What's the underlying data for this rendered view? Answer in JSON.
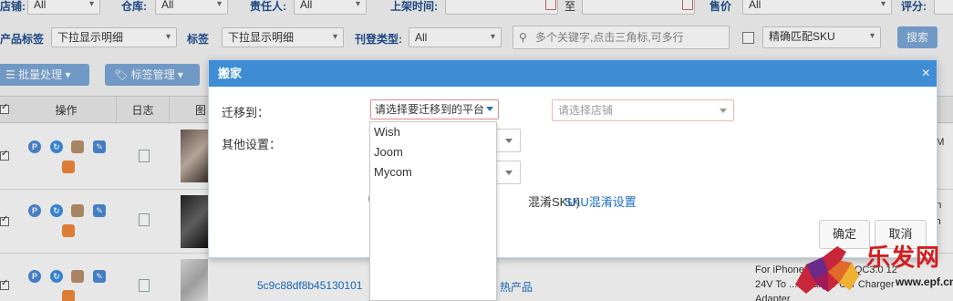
{
  "filters_row1": {
    "store_label": "店铺:",
    "store_value": "All",
    "warehouse_label": "仓库:",
    "warehouse_value": "All",
    "owner_label": "责任人:",
    "owner_value": "All",
    "listing_time_label": "上架时间:",
    "range_to": "至",
    "price_label": "售价",
    "price_value": "All",
    "rating_label": "评分:"
  },
  "filters_row2": {
    "product_tag_label": "产品标签",
    "product_tag_value": "下拉显示明细",
    "tag_label": "标签",
    "tag_value": "下拉显示明细",
    "publish_type_label": "刊登类型:",
    "publish_type_value": "All",
    "keyword_placeholder": "多个关键字,点击三角标,可多行",
    "exact_sku_label": "精确匹配SKU",
    "search_button": "搜索"
  },
  "toolbar": {
    "batch_label": "批量处理",
    "tag_manage_label": "标签管理"
  },
  "table": {
    "headers": [
      "操作",
      "日志",
      "图"
    ],
    "rows": [
      {
        "right_text": "nt M"
      },
      {
        "right_text": "hon\nach"
      },
      {
        "sku_link": "5c9c88df8b45130101",
        "hot_label": "热产品",
        "desc_line1": "For iPhone ... Huawei QC3.0 12",
        "desc_line2": "24V To ... Charger Car Charger",
        "desc_line3": "Adapter"
      }
    ]
  },
  "modal": {
    "title": "搬家",
    "close_symbol": "×",
    "migrate_label": "迁移到：",
    "platform_placeholder": "请选择要迁移到的平台",
    "store_placeholder": "请选择店铺",
    "other_settings_label": "其他设置：",
    "sku_note": "混淆SKU)",
    "sku_link": "SKU混淆设置",
    "confirm_button": "确定",
    "cancel_button": "取消"
  },
  "platform_options": [
    "Wish",
    "Joom",
    "Mycom"
  ],
  "watermark": {
    "text": "乐发网",
    "url": "www.epf.cn"
  },
  "colors": {
    "modal_header": "#3e8cd3",
    "link": "#1a6ec2",
    "watermark": "#d21e1e"
  }
}
